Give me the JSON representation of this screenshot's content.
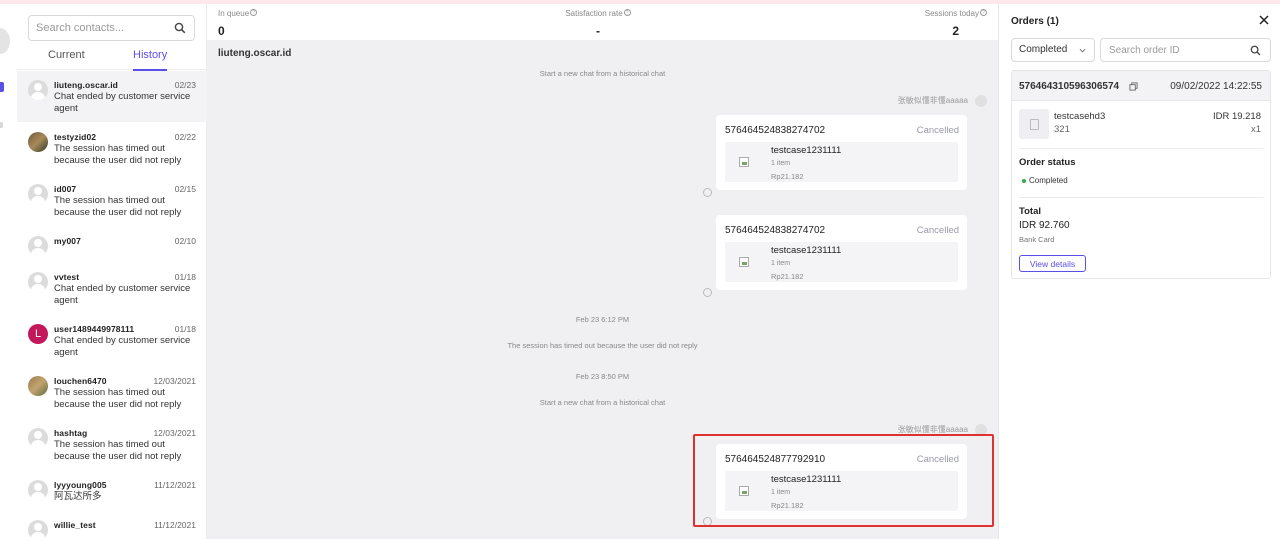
{
  "contacts": {
    "search_placeholder": "Search contacts...",
    "tabs": [
      {
        "label": "Current",
        "active": false
      },
      {
        "label": "History",
        "active": true
      }
    ],
    "items": [
      {
        "name": "liuteng.oscar.id",
        "date": "02/23",
        "message": "Chat ended by customer service agent",
        "avatar": "generic"
      },
      {
        "name": "testyzid02",
        "date": "02/22",
        "message": "The session has timed out because the user did not reply",
        "avatar": "photo"
      },
      {
        "name": "id007",
        "date": "02/15",
        "message": "The session has timed out because the user did not reply",
        "avatar": "generic"
      },
      {
        "name": "my007",
        "date": "02/10",
        "message": "",
        "avatar": "generic"
      },
      {
        "name": "vvtest",
        "date": "01/18",
        "message": "Chat ended by customer service agent",
        "avatar": "generic"
      },
      {
        "name": "user1489449978111",
        "date": "01/18",
        "message": "Chat ended by customer service agent",
        "avatar": "letter",
        "avatar_letter": "L"
      },
      {
        "name": "louchen6470",
        "date": "12/03/2021",
        "message": "The session has timed out because the user did not reply",
        "avatar": "photo2"
      },
      {
        "name": "hashtag",
        "date": "12/03/2021",
        "message": "The session has timed out because the user did not reply",
        "avatar": "generic"
      },
      {
        "name": "lyyyoung005",
        "date": "11/12/2021",
        "message": "阿瓦达所多",
        "avatar": "generic"
      },
      {
        "name": "willie_test",
        "date": "11/12/2021",
        "message": "",
        "avatar": "generic"
      }
    ]
  },
  "stats": {
    "in_queue": {
      "label": "In queue",
      "value": "0"
    },
    "satisfaction": {
      "label": "Satisfaction rate",
      "value": "-"
    },
    "sessions_today": {
      "label": "Sessions today",
      "value": "2"
    }
  },
  "chat": {
    "title": "liuteng.oscar.id",
    "system_messages": [
      "Start a new chat from a historical chat",
      "Feb 23 6:12 PM",
      "The session has timed out because the user did not reply",
      "Feb 23 8:50 PM",
      "Start a new chat from a historical chat"
    ],
    "sender_name": "张敏似懂非懂aaaaa",
    "order_cards": [
      {
        "order_id": "576464524838274702",
        "status": "Cancelled",
        "product": "testcase1231111",
        "qty": "1 item",
        "price": "Rp21.182"
      },
      {
        "order_id": "576464524838274702",
        "status": "Cancelled",
        "product": "testcase1231111",
        "qty": "1 item",
        "price": "Rp21.182"
      },
      {
        "order_id": "576464524877792910",
        "status": "Cancelled",
        "product": "testcase1231111",
        "qty": "1 item",
        "price": "Rp21.182"
      }
    ]
  },
  "orders": {
    "title": "Orders (1)",
    "filter_value": "Completed",
    "search_placeholder": "Search order ID",
    "order": {
      "number": "576464310596306574",
      "datetime": "09/02/2022 14:22:55",
      "product_name": "testcasehd3",
      "product_sku": "321",
      "product_price": "IDR 19.218",
      "product_qty": "x1",
      "status_label": "Order status",
      "status_value": "Completed",
      "total_label": "Total",
      "total_value": "IDR 92.760",
      "payment": "Bank Card",
      "details_button": "View details"
    }
  },
  "colors": {
    "accent": "#5b4fe9",
    "highlight": "#e03131",
    "status_completed": "#2eaa4a",
    "status_cancelled": "#9a9aaa"
  }
}
